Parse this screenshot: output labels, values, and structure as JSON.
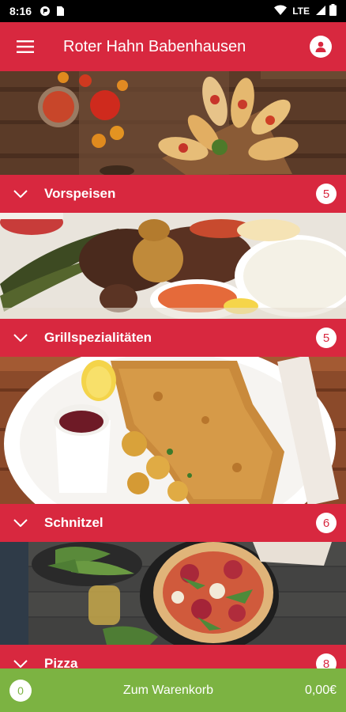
{
  "status_bar": {
    "time": "8:16",
    "network": "LTE",
    "icons": [
      "signal-app-icon",
      "sim-card-icon",
      "wifi-icon",
      "cell-signal-icon",
      "battery-icon"
    ]
  },
  "app_bar": {
    "title": "Roter Hahn Babenhausen",
    "menu_icon": "hamburger-menu-icon",
    "account_icon": "account-icon"
  },
  "categories": [
    {
      "label": "Vorspeisen",
      "count": "5"
    },
    {
      "label": "Grillspezialitäten",
      "count": "5"
    },
    {
      "label": "Schnitzel",
      "count": "6"
    },
    {
      "label": "Pizza",
      "count": "8"
    }
  ],
  "cart": {
    "count": "0",
    "label": "Zum Warenkorb",
    "total": "0,00€"
  },
  "colors": {
    "primary": "#d8283f",
    "cart_bar": "#7cb342",
    "status_bar": "#000000"
  }
}
